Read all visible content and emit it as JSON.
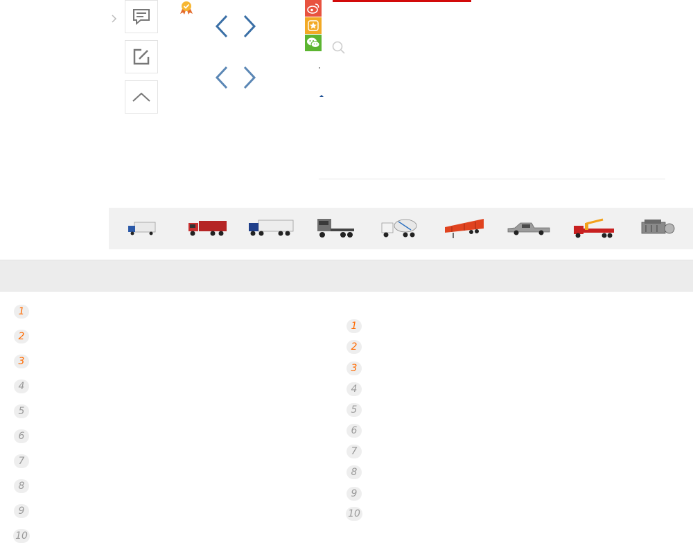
{
  "left_tools": {
    "icons": [
      "chevron-right-icon",
      "comment-icon",
      "edit-icon",
      "chevron-up-icon"
    ]
  },
  "share": {
    "icons": [
      "weibo-icon",
      "favorite-star-icon",
      "wechat-icon"
    ],
    "colors": {
      "weibo": "#e8523f",
      "favorite": "#f2a925",
      "wechat": "#5cb531"
    }
  },
  "accent_colors": {
    "red_bar": "#d20a0a",
    "arrow": "#3a6fa6",
    "rank_top": "#ff6a00",
    "rank_normal": "#999999"
  },
  "vehicle_categories": [
    "light-truck-icon",
    "dump-truck-icon",
    "box-truck-icon",
    "tractor-head-icon",
    "mixer-truck-icon",
    "semi-trailer-icon",
    "pickup-truck-icon",
    "crane-truck-icon",
    "engine-icon"
  ],
  "rank_list_left": [
    "1",
    "2",
    "3",
    "4",
    "5",
    "6",
    "7",
    "8",
    "9",
    "10"
  ],
  "rank_list_right": [
    "1",
    "2",
    "3",
    "4",
    "5",
    "6",
    "7",
    "8",
    "9",
    "10"
  ]
}
